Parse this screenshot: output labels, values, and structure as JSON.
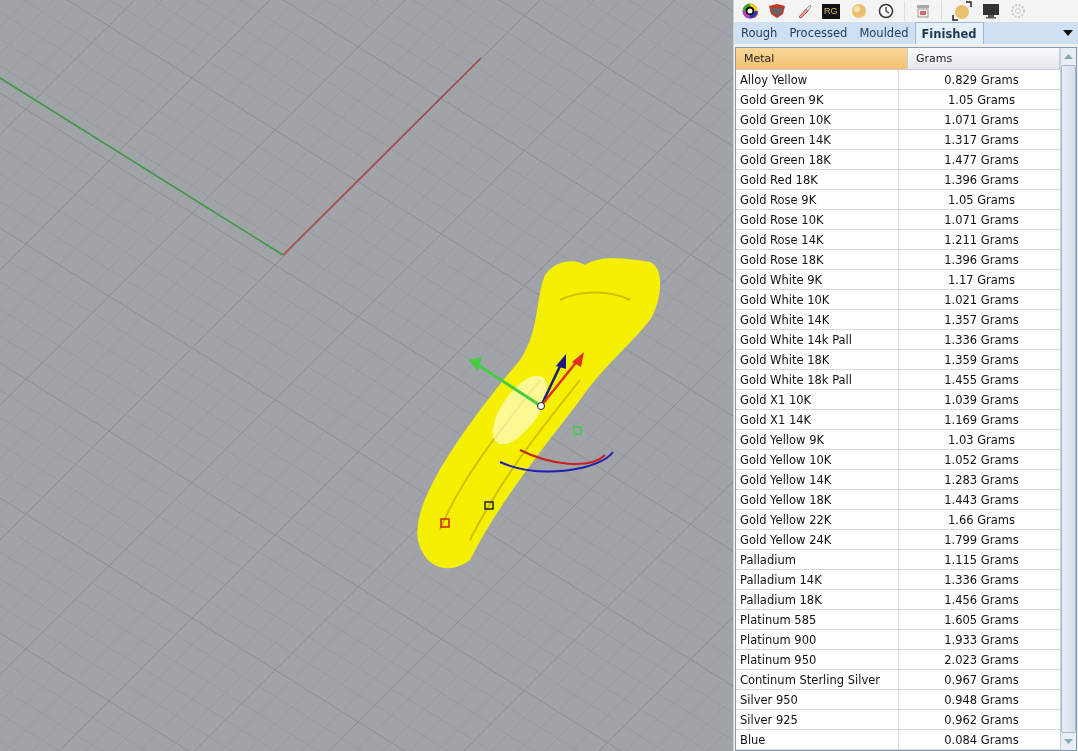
{
  "toolbar": {
    "badge_text": "RG"
  },
  "tabs": [
    {
      "label": "Rough",
      "selected": false
    },
    {
      "label": "Processed",
      "selected": false
    },
    {
      "label": "Moulded",
      "selected": false
    },
    {
      "label": "Finished",
      "selected": true
    }
  ],
  "table": {
    "columns": [
      {
        "label": "Metal",
        "selected": true
      },
      {
        "label": "Grams",
        "selected": false
      }
    ],
    "rows": [
      [
        "Alloy Yellow",
        "0.829 Grams"
      ],
      [
        "Gold Green 9K",
        "1.05 Grams"
      ],
      [
        "Gold Green 10K",
        "1.071 Grams"
      ],
      [
        "Gold Green 14K",
        "1.317 Grams"
      ],
      [
        "Gold Green 18K",
        "1.477 Grams"
      ],
      [
        "Gold Red 18K",
        "1.396 Grams"
      ],
      [
        "Gold Rose 9K",
        "1.05 Grams"
      ],
      [
        "Gold Rose 10K",
        "1.071 Grams"
      ],
      [
        "Gold Rose 14K",
        "1.211 Grams"
      ],
      [
        "Gold Rose 18K",
        "1.396 Grams"
      ],
      [
        "Gold White 9K",
        "1.17 Grams"
      ],
      [
        "Gold White 10K",
        "1.021 Grams"
      ],
      [
        "Gold White 14K",
        "1.357 Grams"
      ],
      [
        "Gold White 14k Pall",
        "1.336 Grams"
      ],
      [
        "Gold White 18K",
        "1.359 Grams"
      ],
      [
        "Gold White 18k Pall",
        "1.455 Grams"
      ],
      [
        "Gold X1 10K",
        "1.039 Grams"
      ],
      [
        "Gold X1 14K",
        "1.169 Grams"
      ],
      [
        "Gold Yellow 9K",
        "1.03 Grams"
      ],
      [
        "Gold Yellow 10K",
        "1.052 Grams"
      ],
      [
        "Gold Yellow 14K",
        "1.283 Grams"
      ],
      [
        "Gold Yellow 18K",
        "1.443 Grams"
      ],
      [
        "Gold Yellow 22K",
        "1.66 Grams"
      ],
      [
        "Gold Yellow 24K",
        "1.799 Grams"
      ],
      [
        "Palladium",
        "1.115 Grams"
      ],
      [
        "Palladium 14K",
        "1.336 Grams"
      ],
      [
        "Palladium 18K",
        "1.456 Grams"
      ],
      [
        "Platinum 585",
        "1.605 Grams"
      ],
      [
        "Platinum 900",
        "1.933 Grams"
      ],
      [
        "Platinum 950",
        "2.023 Grams"
      ],
      [
        "Continum Sterling Silver",
        "0.967 Grams"
      ],
      [
        "Silver 950",
        "0.948 Grams"
      ],
      [
        "Silver 925",
        "0.962 Grams"
      ],
      [
        "Blue",
        "0.084 Grams"
      ]
    ]
  }
}
